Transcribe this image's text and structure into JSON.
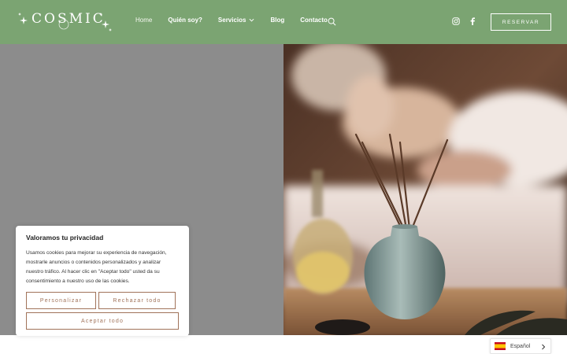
{
  "header": {
    "logo_text": "COSMIC",
    "nav": [
      {
        "label": "Home"
      },
      {
        "label": "Quién soy?"
      },
      {
        "label": "Servicios"
      },
      {
        "label": "Blog"
      },
      {
        "label": "Contacto"
      }
    ],
    "reserve_label": "RESERVAR",
    "icons": [
      "search-icon",
      "instagram-icon",
      "facebook-icon",
      "chevron-down-icon"
    ]
  },
  "cookie": {
    "title": "Valoramos tu privacidad",
    "body": "Usamos cookies para mejorar su experiencia de navegación, mostrarle anuncios o contenidos personalizados y analizar nuestro tráfico. Al hacer clic en \"Aceptar todo\" usted da su consentimiento a nuestro uso de las cookies.",
    "customize_label": "Personalizar",
    "reject_label": "Rechazar todo",
    "accept_label": "Aceptar todo"
  },
  "language": {
    "label": "Español"
  },
  "colors": {
    "header_bg": "#7ba472",
    "hero_left_bg": "#8c8c8c",
    "button_accent": "#a1735a"
  }
}
